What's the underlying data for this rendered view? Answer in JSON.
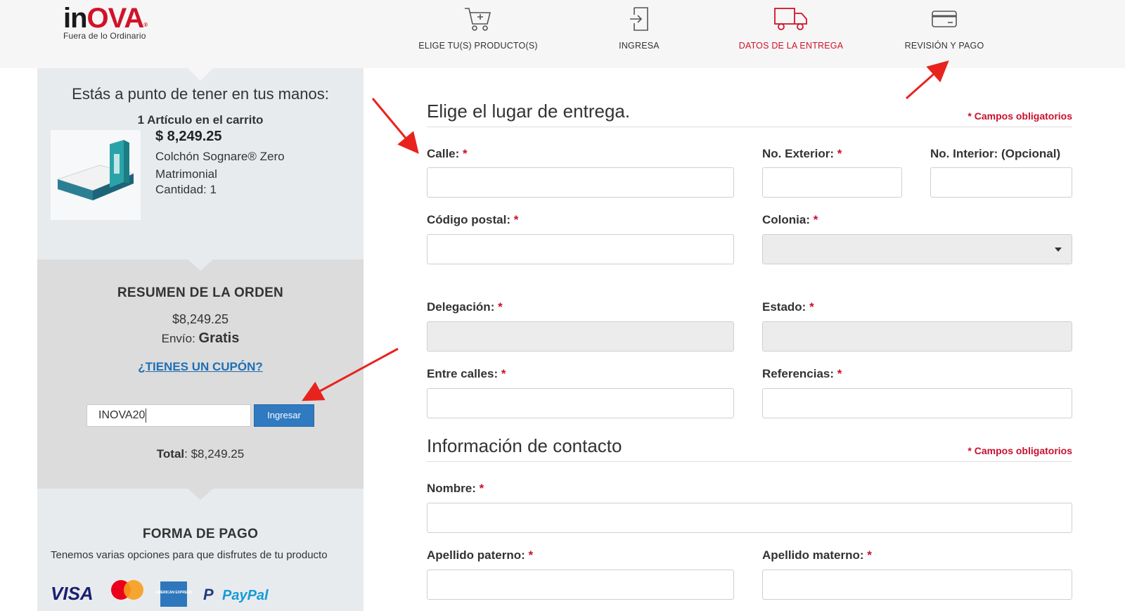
{
  "brand": {
    "name_part1": "in",
    "name_part2": "OVA",
    "reg": "®",
    "tagline": "Fuera de lo Ordinario"
  },
  "steps": [
    {
      "label": "ELIGE TU(S) PRODUCTO(S)",
      "icon": "cart-icon",
      "active": false
    },
    {
      "label": "INGRESA",
      "icon": "login-icon",
      "active": false
    },
    {
      "label": "DATOS DE LA ENTREGA",
      "icon": "truck-icon",
      "active": true
    },
    {
      "label": "REVISIÓN Y PAGO",
      "icon": "credit-card-icon",
      "active": false
    }
  ],
  "cart": {
    "heading": "Estás a punto de tener en tus manos:",
    "count_label": "1 Artículo en el carrito",
    "item": {
      "price": "$ 8,249.25",
      "name": "Colchón Sognare® Zero Matrimonial",
      "quantity": "Cantidad: 1"
    }
  },
  "summary": {
    "title": "RESUMEN DE LA ORDEN",
    "subtotal": "$8,249.25",
    "shipping_label": "Envío: ",
    "shipping_value": "Gratis",
    "coupon_link": "¿TIENES UN CUPÓN?",
    "coupon_value": "INOVA20",
    "coupon_button": "Ingresar",
    "total_label": "Total",
    "total_value": ": $8,249.25"
  },
  "payment": {
    "title": "FORMA DE PAGO",
    "text": "Tenemos varias opciones para que disfrutes de tu producto",
    "methods": [
      "VISA",
      "Mastercard",
      "AMERICAN EXPRESS",
      "PayPal"
    ]
  },
  "delivery": {
    "title": "Elige el lugar de entrega.",
    "required_note": "* Campos obligatorios",
    "fields": {
      "calle": "Calle:",
      "no_exterior": "No. Exterior:",
      "no_interior": "No. Interior: (Opcional)",
      "codigo_postal": "Código postal:",
      "colonia": "Colonia:",
      "delegacion": "Delegación:",
      "estado": "Estado:",
      "entre_calles": "Entre calles:",
      "referencias": "Referencias:"
    },
    "star": "*"
  },
  "contact": {
    "title": "Información de contacto",
    "required_note": "* Campos obligatorios",
    "fields": {
      "nombre": "Nombre:",
      "apellido_paterno": "Apellido paterno:",
      "apellido_materno": "Apellido materno:"
    }
  },
  "colors": {
    "accent": "#d11329",
    "link": "#1f6fb4",
    "button": "#2f7ac0",
    "annotation_arrow": "#e8231e"
  }
}
